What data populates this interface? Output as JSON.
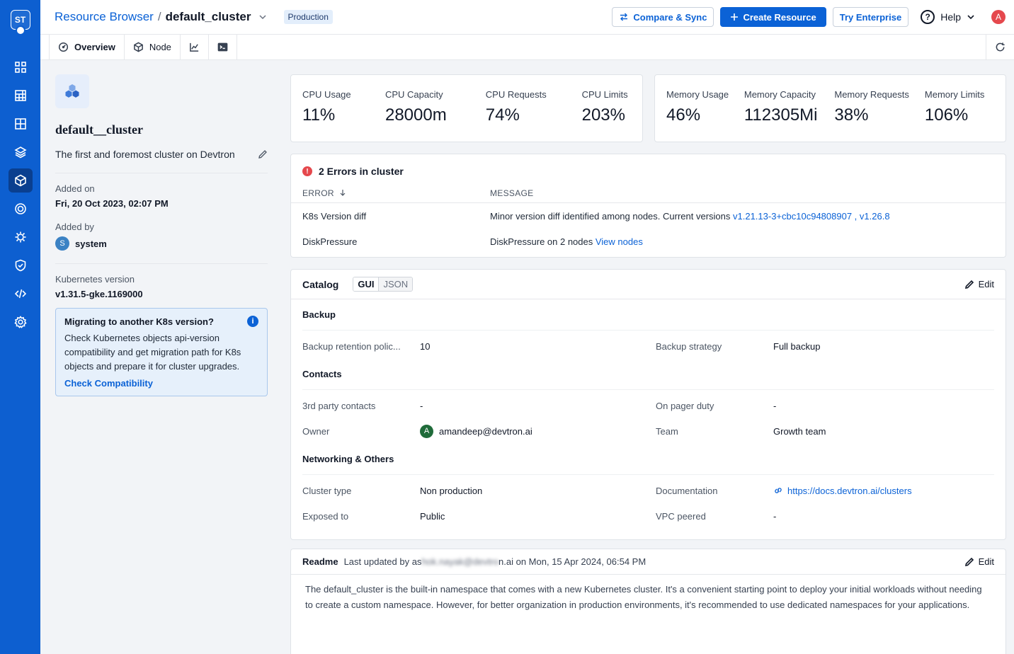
{
  "sidebar": {
    "logo_text": "ST",
    "items": [
      {
        "icon": "grid-icon"
      },
      {
        "icon": "table-grid-icon"
      },
      {
        "icon": "app-grid-icon"
      },
      {
        "icon": "stack-icon"
      },
      {
        "icon": "cube-icon",
        "active": true
      },
      {
        "icon": "target-icon"
      },
      {
        "icon": "bug-icon"
      },
      {
        "icon": "shield-icon"
      },
      {
        "icon": "code-icon"
      },
      {
        "icon": "gear-icon"
      }
    ]
  },
  "header": {
    "crumb_root": "Resource Browser",
    "crumb_sep": "/",
    "crumb_current": "default_cluster",
    "env_badge": "Production",
    "compare_label": "Compare & Sync",
    "create_label": "Create Resource",
    "enterprise_label": "Try Enterprise",
    "help_label": "Help",
    "avatar_letter": "A"
  },
  "tabs": [
    {
      "label": "Overview",
      "icon": "overview-icon"
    },
    {
      "label": "Node",
      "icon": "node-icon"
    }
  ],
  "cluster": {
    "name": "default__cluster",
    "description": "The first and foremost cluster on Devtron",
    "added_on_label": "Added on",
    "added_on": "Fri, 20 Oct 2023, 02:07 PM",
    "added_by_label": "Added by",
    "added_by_initial": "S",
    "added_by": "system",
    "k8s_label": "Kubernetes version",
    "k8s_version": "v1.31.5-gke.1169000"
  },
  "migrate": {
    "title": "Migrating to another K8s version?",
    "body": "Check Kubernetes objects api-version compatibility and get migration path for K8s objects and prepare it for cluster upgrades.",
    "link": "Check Compatibility"
  },
  "cpu": [
    {
      "label": "CPU Usage",
      "value": "11%"
    },
    {
      "label": "CPU Capacity",
      "value": "28000m"
    },
    {
      "label": "CPU Requests",
      "value": "74%"
    },
    {
      "label": "CPU Limits",
      "value": "203%"
    }
  ],
  "memory": [
    {
      "label": "Memory Usage",
      "value": "46%"
    },
    {
      "label": "Memory Capacity",
      "value": "112305Mi"
    },
    {
      "label": "Memory Requests",
      "value": "38%"
    },
    {
      "label": "Memory Limits",
      "value": "106%"
    }
  ],
  "errors": {
    "title": "2 Errors in cluster",
    "col_error": "ERROR",
    "col_message": "MESSAGE",
    "rows": [
      {
        "error": "K8s Version diff",
        "message": "Minor version diff identified among nodes. Current versions ",
        "link1": "v1.21.13-3+cbc10c94808907",
        "sep": " , ",
        "link2": "v1.26.8"
      },
      {
        "error": "DiskPressure",
        "message": "DiskPressure on 2 nodes ",
        "link1": "View nodes"
      }
    ]
  },
  "catalog": {
    "title": "Catalog",
    "gui": "GUI",
    "json": "JSON",
    "edit": "Edit",
    "backup_title": "Backup",
    "backup_retention_label": "Backup retention polic...",
    "backup_retention_value": "10",
    "backup_strategy_label": "Backup strategy",
    "backup_strategy_value": "Full backup",
    "contacts_title": "Contacts",
    "third_party_label": "3rd party contacts",
    "third_party_value": "-",
    "pager_label": "On pager duty",
    "pager_value": "-",
    "owner_label": "Owner",
    "owner_initial": "A",
    "owner_value": "amandeep@devtron.ai",
    "team_label": "Team",
    "team_value": "Growth team",
    "net_title": "Networking & Others",
    "cluster_type_label": "Cluster type",
    "cluster_type_value": "Non production",
    "doc_label": "Documentation",
    "doc_value": "https://docs.devtron.ai/clusters",
    "exposed_label": "Exposed to",
    "exposed_value": "Public",
    "vpc_label": "VPC peered",
    "vpc_value": "-"
  },
  "readme": {
    "title": "Readme",
    "meta_prefix": "Last updated by as",
    "meta_blur": "hok.nayak@devtro",
    "meta_suffix": "n.ai on Mon, 15 Apr 2024, 06:54 PM",
    "edit": "Edit",
    "body": "The default_cluster is the built-in namespace that comes with a new Kubernetes cluster. It's a convenient starting point to deploy your initial workloads without needing to create a custom namespace. However, for better organization in production environments, it's recommended to use dedicated namespaces for your applications."
  }
}
